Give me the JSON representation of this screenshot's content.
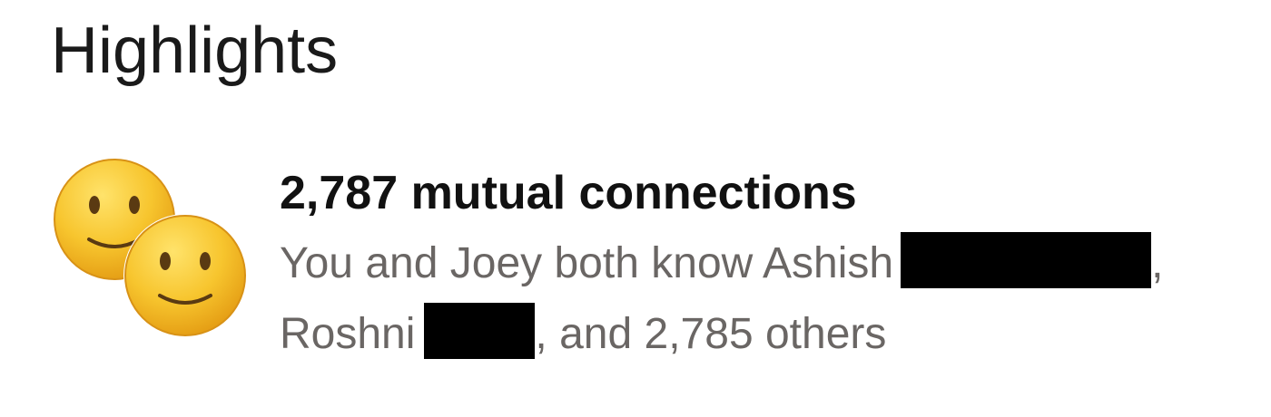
{
  "highlights": {
    "title": "Highlights",
    "mutual": {
      "headline": "2,787 mutual connections",
      "line1_prefix": "You and Joey both know Ashish",
      "line1_suffix": ",",
      "line2_prefix": "Roshni",
      "line2_suffix": ", and 2,785 others",
      "avatar_icons": [
        "smiley-face-icon",
        "smiley-face-icon"
      ]
    }
  },
  "colors": {
    "title": "#1a1a1a",
    "headline": "#111111",
    "detail_text": "#6a6664",
    "redaction": "#000000",
    "emoji_face": "#f5c028"
  }
}
